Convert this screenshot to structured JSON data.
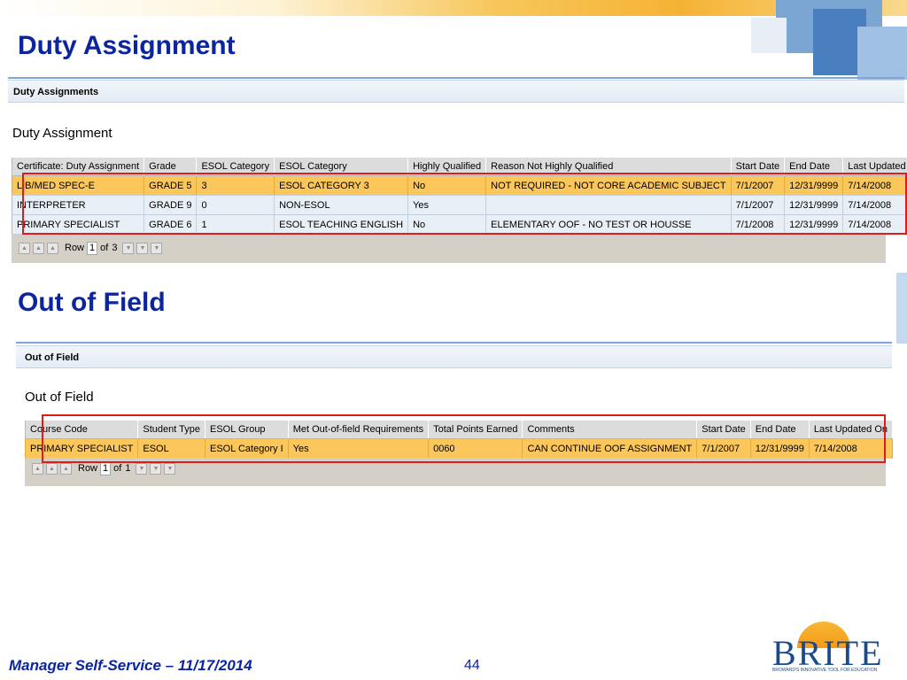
{
  "slide": {
    "title1": "Duty Assignment",
    "title2": "Out of Field",
    "footer": "Manager Self-Service – 11/17/2014",
    "page_number": "44",
    "logo": {
      "name": "BRITE",
      "tagline": "BROWARD'S INNOVATIVE TOOL FOR EDUCATION"
    }
  },
  "colors": {
    "title_blue": "#0b24a0",
    "selected_row": "#fbc65a",
    "normal_row": "#e9eff7",
    "highlight_border": "#e01b1b"
  },
  "duty_panel": {
    "header": "Duty Assignments",
    "title": "Duty Assignment",
    "columns": [
      "Certificate: Duty Assignment",
      "Grade",
      "ESOL Category",
      "ESOL Category",
      "Highly Qualified",
      "Reason Not Highly Qualified",
      "Start Date",
      "End Date",
      "Last Updated On"
    ],
    "rows": [
      [
        "LIB/MED SPEC-E",
        "GRADE 5",
        "3",
        "ESOL CATEGORY 3",
        "No",
        "NOT REQUIRED - NOT CORE ACADEMIC SUBJECT",
        "7/1/2007",
        "12/31/9999",
        "7/14/2008"
      ],
      [
        "INTERPRETER",
        "GRADE 9",
        "0",
        "NON-ESOL",
        "Yes",
        "",
        "7/1/2007",
        "12/31/9999",
        "7/14/2008"
      ],
      [
        "PRIMARY SPECIALIST",
        "GRADE 6",
        "1",
        "ESOL TEACHING ENGLISH",
        "No",
        "ELEMENTARY OOF - NO TEST OR HOUSSE",
        "7/1/2008",
        "12/31/9999",
        "7/14/2008"
      ]
    ],
    "pager": {
      "row_label": "Row",
      "current": "1",
      "of_label": "of",
      "total": "3"
    }
  },
  "oof_panel": {
    "header": "Out of Field",
    "title": "Out of Field",
    "columns": [
      "Course Code",
      "Student Type",
      "ESOL Group",
      "Met Out-of-field Requirements",
      "Total Points Earned",
      "Comments",
      "Start Date",
      "End Date",
      "Last Updated On"
    ],
    "rows": [
      [
        "PRIMARY SPECIALIST",
        "ESOL",
        "ESOL Category I",
        "Yes",
        "0060",
        "CAN CONTINUE OOF ASSIGNMENT",
        "7/1/2007",
        "12/31/9999",
        "7/14/2008"
      ]
    ],
    "pager": {
      "row_label": "Row",
      "current": "1",
      "of_label": "of",
      "total": "1"
    }
  }
}
